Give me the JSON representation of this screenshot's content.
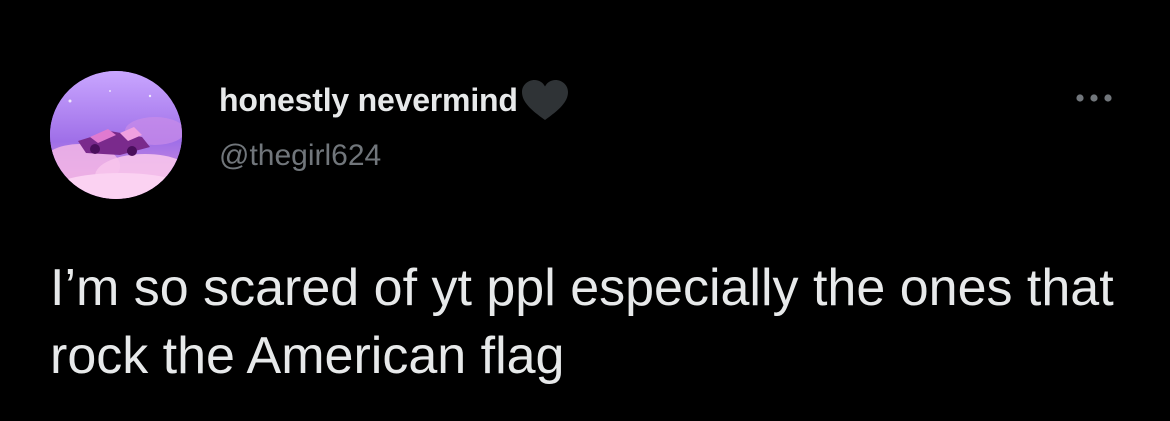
{
  "tweet": {
    "author": {
      "display_name": "honestly nevermind",
      "handle": "@thegirl624"
    },
    "text": "I’m so scared of yt ppl especially the ones that rock the American flag",
    "icons": {
      "name_badge": "black-heart-icon",
      "more": "more-horizontal-icon",
      "avatar": "avatar"
    }
  },
  "colors": {
    "background": "#000000",
    "primary_text": "#e7e9ea",
    "secondary_text": "#71767b"
  }
}
